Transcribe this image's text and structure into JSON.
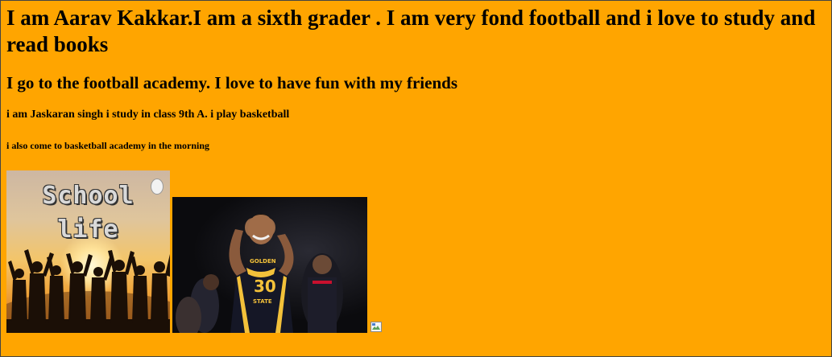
{
  "page": {
    "heading1": "I am Aarav Kakkar.I am a sixth grader . I am very fond football and i love to study and read books",
    "heading2": "I go to the football academy. I love to have fun with my friends",
    "heading4": "i am Jaskaran singh i study in class 9th A. i play basketball",
    "heading5": "i also come to basketball academy in the morning"
  },
  "images": {
    "school_life": {
      "line1": "School",
      "line2": "life"
    },
    "basketball_jersey": {
      "line1": "GOLDEN",
      "line2": "STATE",
      "number": "30"
    }
  },
  "colors": {
    "background": "#FFA500",
    "text": "#000000"
  }
}
